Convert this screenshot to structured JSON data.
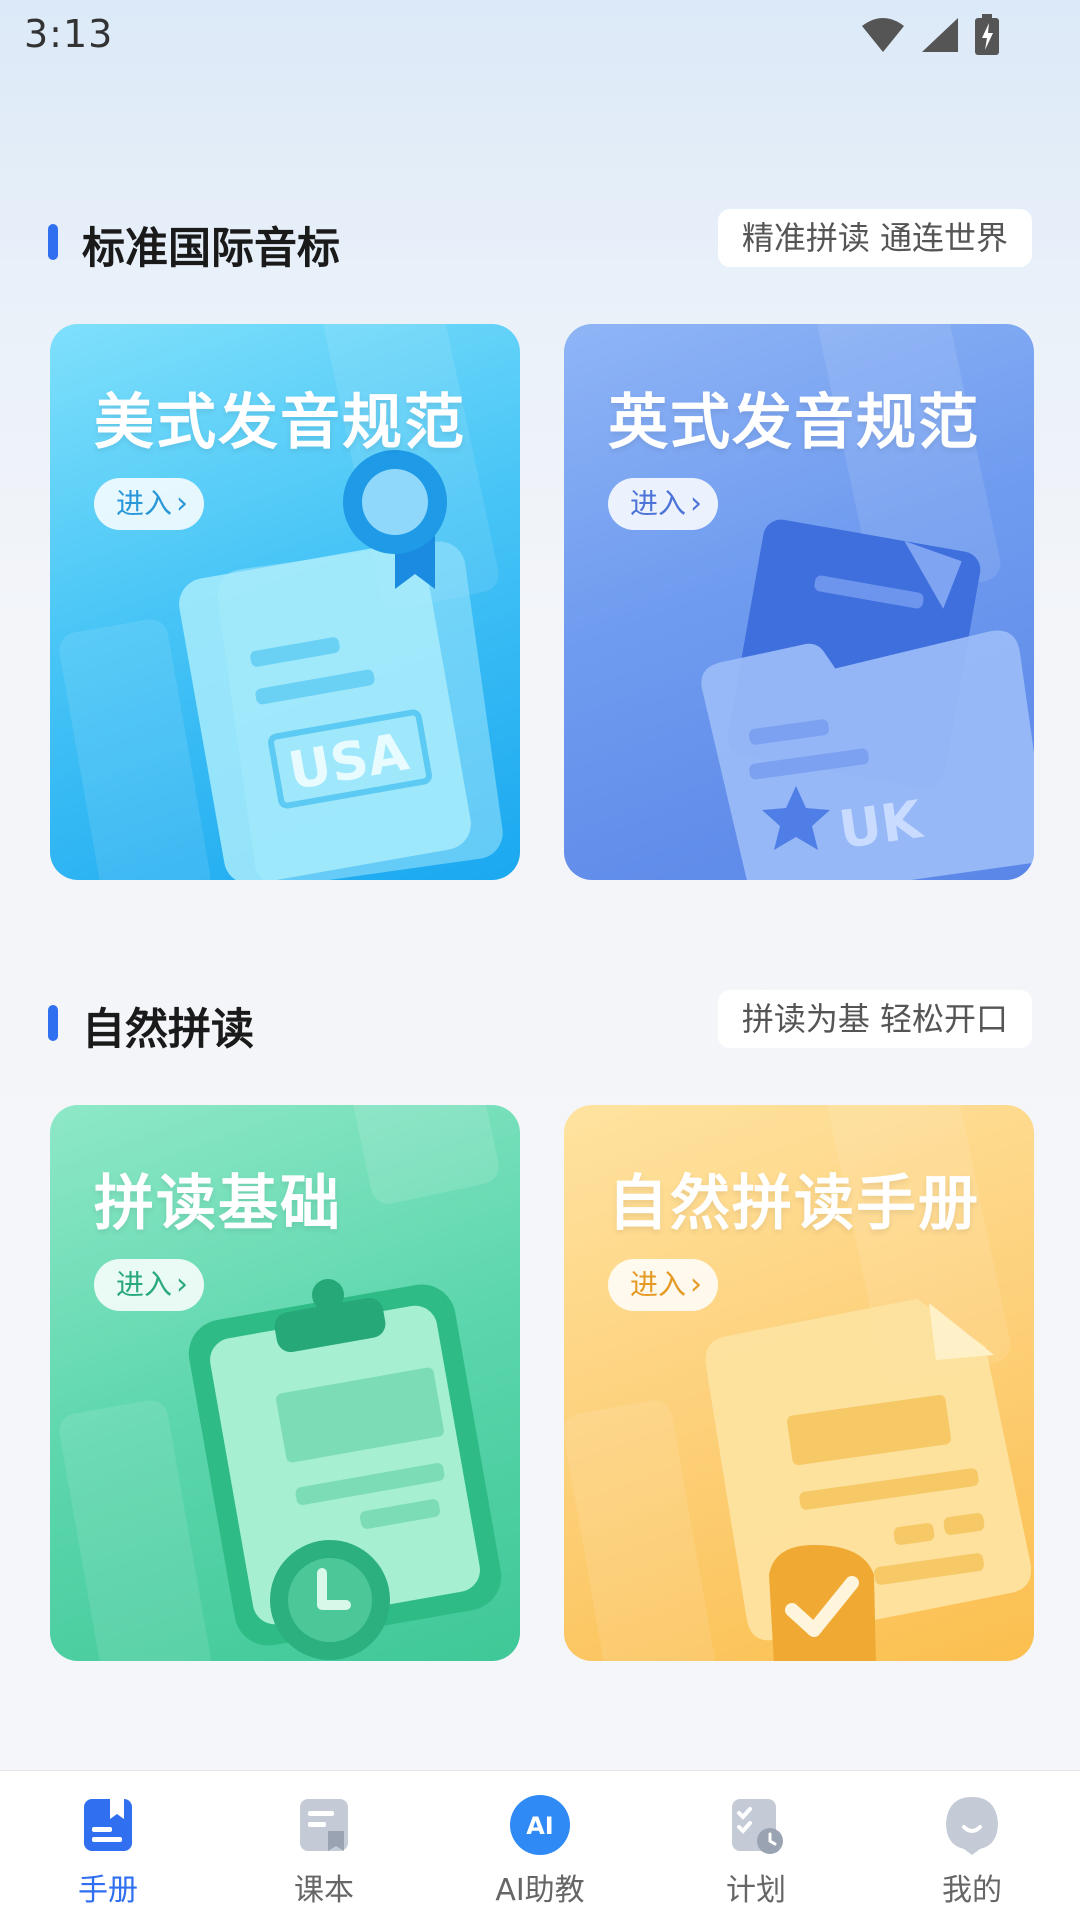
{
  "status_bar": {
    "time": "3:13"
  },
  "sections": [
    {
      "title": "标准国际音标",
      "tag": "精准拼读 通连世界"
    },
    {
      "title": "自然拼读",
      "tag": "拼读为基 轻松开口"
    }
  ],
  "cards": [
    {
      "title": "美式发音规范",
      "button": "进入",
      "badge": "USA"
    },
    {
      "title": "英式发音规范",
      "button": "进入",
      "badge": "UK"
    },
    {
      "title": "拼读基础",
      "button": "进入"
    },
    {
      "title": "自然拼读手册",
      "button": "进入"
    }
  ],
  "nav": [
    {
      "label": "手册",
      "icon": "handbook-icon",
      "active": true
    },
    {
      "label": "课本",
      "icon": "textbook-icon",
      "active": false
    },
    {
      "label": "AI助教",
      "icon": "ai-assistant-icon",
      "active": false,
      "icon_text": "AI"
    },
    {
      "label": "计划",
      "icon": "plan-icon",
      "active": false
    },
    {
      "label": "我的",
      "icon": "profile-icon",
      "active": false
    }
  ],
  "colors": {
    "accent": "#2f6ff0",
    "card_usa": "#48c5f6",
    "card_uk": "#6f9bef",
    "card_basic": "#5cd6ad",
    "card_handbook": "#fdd07a"
  }
}
